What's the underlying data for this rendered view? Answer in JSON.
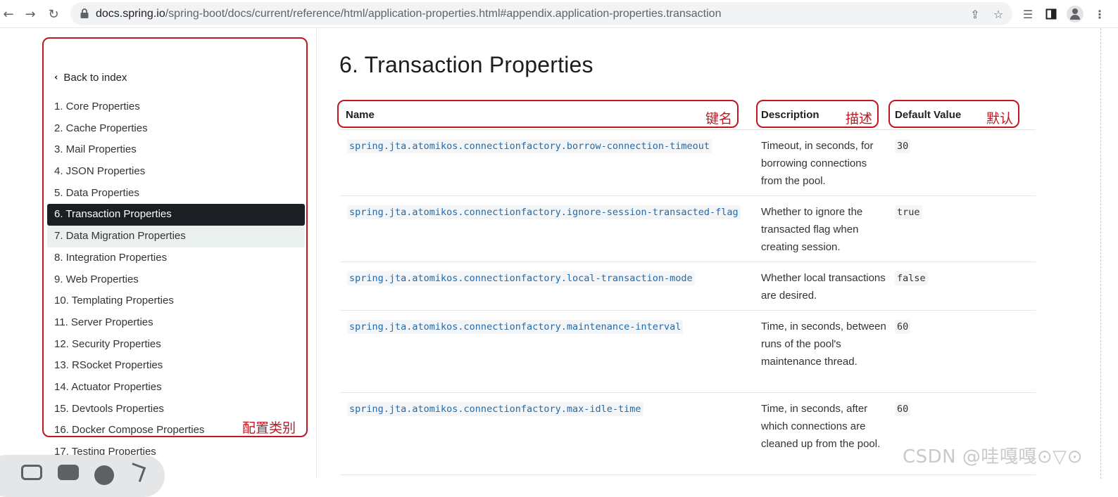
{
  "browser": {
    "back_icon": "arrow-left-icon",
    "forward_icon": "arrow-right-icon",
    "reload_icon": "reload-icon",
    "url_host": "docs.spring.io",
    "url_path": "/spring-boot/docs/current/reference/html/application-properties.html#appendix.application-properties.transaction"
  },
  "sidebar": {
    "back_label": "Back to index",
    "items": [
      {
        "label": "1. Core Properties"
      },
      {
        "label": "2. Cache Properties"
      },
      {
        "label": "3. Mail Properties"
      },
      {
        "label": "4. JSON Properties"
      },
      {
        "label": "5. Data Properties"
      },
      {
        "label": "6. Transaction Properties"
      },
      {
        "label": "7. Data Migration Properties"
      },
      {
        "label": "8. Integration Properties"
      },
      {
        "label": "9. Web Properties"
      },
      {
        "label": "10. Templating Properties"
      },
      {
        "label": "11. Server Properties"
      },
      {
        "label": "12. Security Properties"
      },
      {
        "label": "13. RSocket Properties"
      },
      {
        "label": "14. Actuator Properties"
      },
      {
        "label": "15. Devtools Properties"
      },
      {
        "label": "16. Docker Compose Properties"
      },
      {
        "label": "17. Testing Properties"
      }
    ],
    "active_index": 5,
    "hover_index": 6
  },
  "main": {
    "title": "6. Transaction Properties",
    "columns": {
      "name": "Name",
      "description": "Description",
      "default": "Default Value"
    },
    "rows": [
      {
        "name": "spring.jta.atomikos.connectionfactory.borrow-connection-timeout",
        "description": "Timeout, in seconds, for borrowing connections from the pool.",
        "default": "30"
      },
      {
        "name": "spring.jta.atomikos.connectionfactory.ignore-session-transacted-flag",
        "description": "Whether to ignore the transacted flag when creating session.",
        "default": "true"
      },
      {
        "name": "spring.jta.atomikos.connectionfactory.local-transaction-mode",
        "description": "Whether local transactions are desired.",
        "default": "false"
      },
      {
        "name": "spring.jta.atomikos.connectionfactory.maintenance-interval",
        "description": "Time, in seconds, between runs of the pool's maintenance thread.",
        "default": "60"
      },
      {
        "name": "spring.jta.atomikos.connectionfactory.max-idle-time",
        "description": "Time, in seconds, after which connections are cleaned up from the pool.",
        "default": "60"
      }
    ]
  },
  "annotations": {
    "name_label": "键名",
    "description_label": "描述",
    "default_label": "默认",
    "sidebar_label": "配置类别",
    "color": "#c0161f"
  },
  "watermark": "CSDN @哇嘎嘎⊙▽⊙"
}
